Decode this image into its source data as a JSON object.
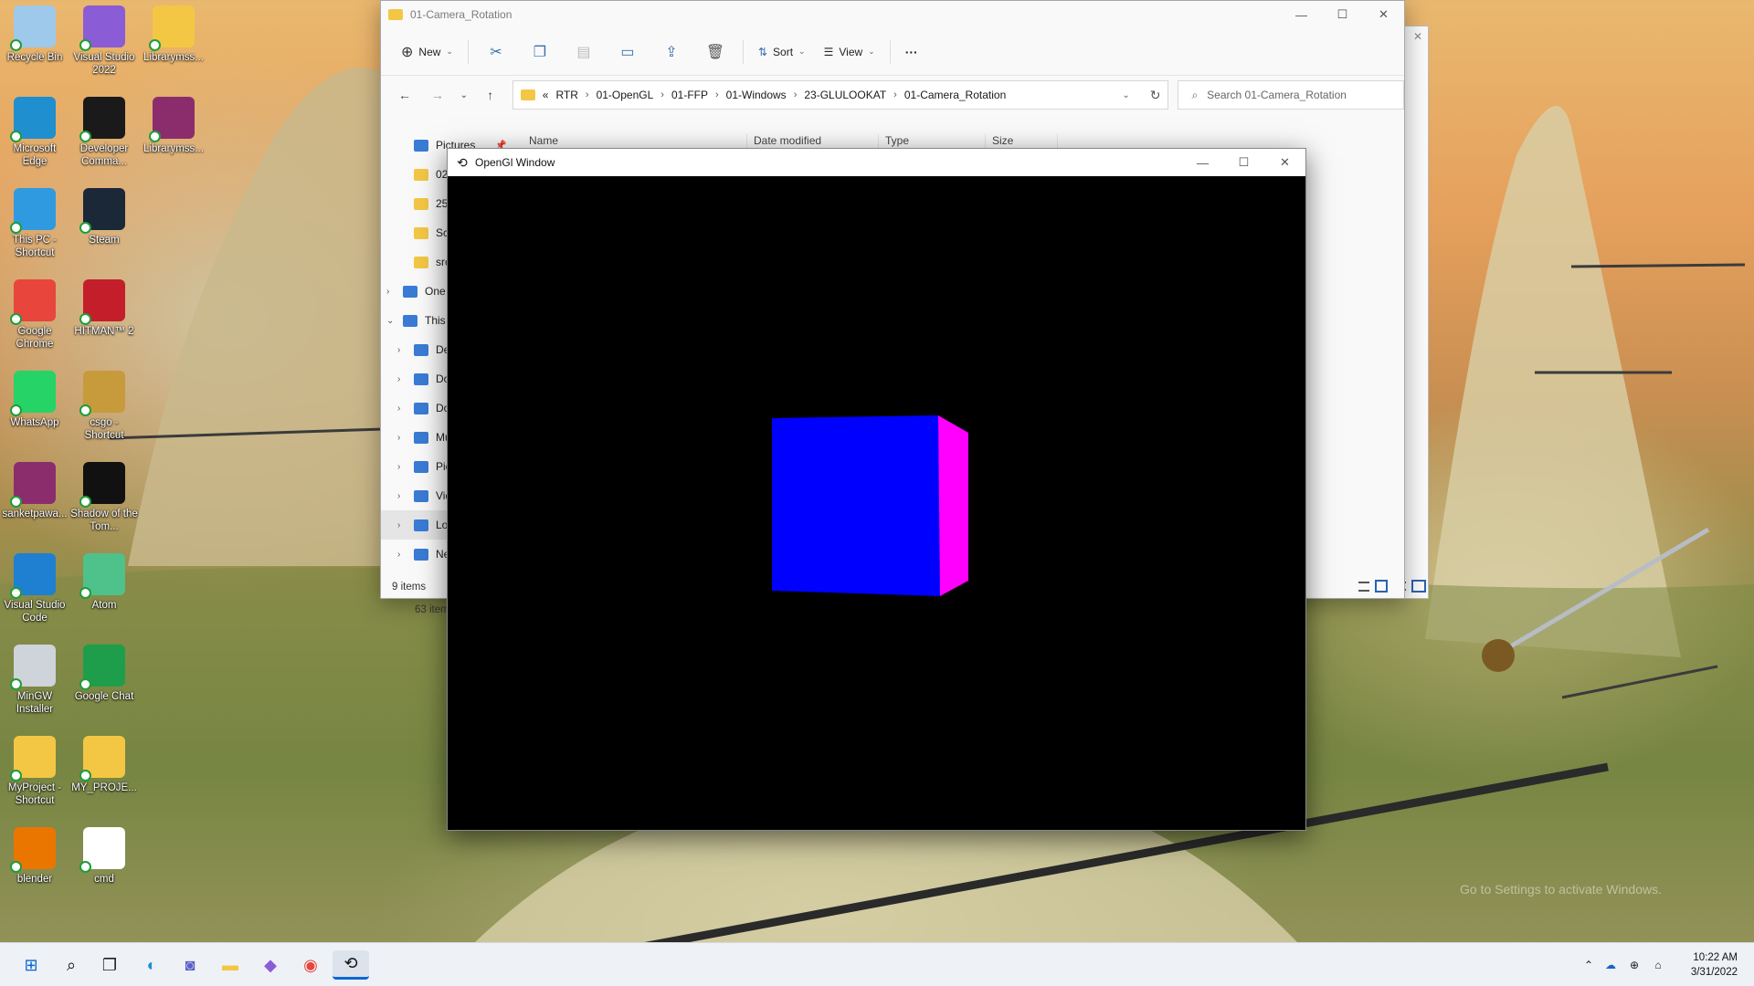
{
  "desktop": {
    "icons": [
      {
        "label": "Recycle Bin",
        "icon": "recycle-bin-icon",
        "color": "#9ec9ea"
      },
      {
        "label": "Visual Studio 2022",
        "icon": "visual-studio-icon",
        "color": "#8a5cd6"
      },
      {
        "label": "Librarymss...",
        "icon": "folder-icon",
        "color": "#f3c744"
      },
      {
        "label": "Microsoft Edge",
        "icon": "edge-icon",
        "color": "#1f8fd0"
      },
      {
        "label": "Developer Comma...",
        "icon": "terminal-icon",
        "color": "#1a1a1a"
      },
      {
        "label": "Librarymss...",
        "icon": "winrar-icon",
        "color": "#8b2d6d"
      },
      {
        "label": "This PC - Shortcut",
        "icon": "monitor-icon",
        "color": "#2f9ae0"
      },
      {
        "label": "Steam",
        "icon": "steam-icon",
        "color": "#1b2838"
      },
      {
        "label": "Google Chrome",
        "icon": "chrome-icon",
        "color": "#e8453c"
      },
      {
        "label": "HITMAN™ 2",
        "icon": "hitman-icon",
        "color": "#c41e2a"
      },
      {
        "label": "WhatsApp",
        "icon": "whatsapp-icon",
        "color": "#25d366"
      },
      {
        "label": "csgo - Shortcut",
        "icon": "csgo-icon",
        "color": "#c79a3b"
      },
      {
        "label": "sanketpawa...",
        "icon": "winrar-icon",
        "color": "#8b2d6d"
      },
      {
        "label": "Shadow of the Tom...",
        "icon": "game-icon",
        "color": "#111111"
      },
      {
        "label": "Visual Studio Code",
        "icon": "vscode-icon",
        "color": "#1f7fd0"
      },
      {
        "label": "Atom",
        "icon": "atom-icon",
        "color": "#4ec28a"
      },
      {
        "label": "MinGW Installer",
        "icon": "installer-icon",
        "color": "#cfd3da"
      },
      {
        "label": "Google Chat",
        "icon": "google-chat-icon",
        "color": "#1e9e4a"
      },
      {
        "label": "MyProject - Shortcut",
        "icon": "folder-icon",
        "color": "#f3c744"
      },
      {
        "label": "MY_PROJE...",
        "icon": "folder-icon",
        "color": "#f3c744"
      },
      {
        "label": "blender",
        "icon": "blender-icon",
        "color": "#ea7600"
      },
      {
        "label": "cmd",
        "icon": "file-icon",
        "color": "#ffffff"
      }
    ]
  },
  "explorer": {
    "title": "01-Camera_Rotation",
    "toolbar": {
      "new": "New",
      "sort": "Sort",
      "view": "View",
      "more": "···"
    },
    "breadcrumb": {
      "prefix": "«",
      "items": [
        "RTR",
        "01-OpenGL",
        "01-FFP",
        "01-Windows",
        "23-GLULOOKAT",
        "01-Camera_Rotation"
      ]
    },
    "search_placeholder": "Search 01-Camera_Rotation",
    "columns": [
      "Name",
      "Date modified",
      "Type",
      "Size"
    ],
    "sidebar": [
      {
        "label": "Pictures",
        "icon": "pictures-icon",
        "pinned": true
      },
      {
        "label": "02_",
        "icon": "folder-icon"
      },
      {
        "label": "25-",
        "icon": "folder-icon"
      },
      {
        "label": "Scr",
        "icon": "folder-icon"
      },
      {
        "label": "src",
        "icon": "folder-icon"
      },
      {
        "label": "One",
        "icon": "onedrive-icon"
      },
      {
        "label": "This",
        "icon": "this-pc-icon"
      },
      {
        "label": "De",
        "icon": "desktop-icon"
      },
      {
        "label": "Do",
        "icon": "documents-icon"
      },
      {
        "label": "Do",
        "icon": "downloads-icon"
      },
      {
        "label": "Mu",
        "icon": "music-icon"
      },
      {
        "label": "Pic",
        "icon": "pictures-icon"
      },
      {
        "label": "Vid",
        "icon": "videos-icon"
      },
      {
        "label": "Lo",
        "icon": "local-disk-icon"
      },
      {
        "label": "Ne",
        "icon": "network-icon"
      }
    ],
    "status": "9 items",
    "status_behind": "63 item"
  },
  "opengl": {
    "title": "OpenGl Window",
    "cube": {
      "front_color": "#0000ff",
      "side_color": "#ff00ff"
    }
  },
  "taskbar": {
    "apps": [
      "start-icon",
      "search-icon",
      "task-view-icon",
      "edge-icon",
      "teams-chat-icon",
      "file-explorer-icon",
      "visual-studio-icon",
      "chrome-icon",
      "opengl-app-icon"
    ],
    "time": "10:22 AM",
    "date": "3/31/2022"
  },
  "watermark": "Go to Settings to activate Windows."
}
